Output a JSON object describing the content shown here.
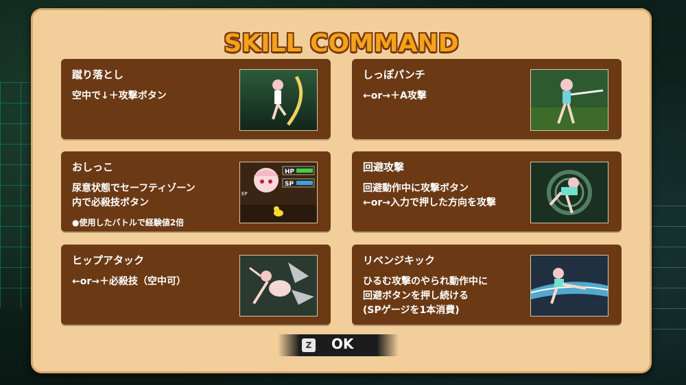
{
  "title": "SKILL COMMAND",
  "skills": [
    {
      "name": "蹴り落とし",
      "desc": "空中で↓＋攻撃ボタン",
      "note": "",
      "thumb_icon": "kick-down-scene"
    },
    {
      "name": "しっぽパンチ",
      "desc": "←or→＋A攻撃",
      "note": "",
      "thumb_icon": "tail-punch-scene"
    },
    {
      "name": "おしっこ",
      "desc": "尿意状態でセーフティゾーン\n内で必殺技ボタン",
      "note": "●使用したバトルで経験値2倍",
      "thumb_icon": "status-portrait-scene"
    },
    {
      "name": "回避攻撃",
      "desc": "回避動作中に攻撃ボタン\n←or→入力で押した方向を攻撃",
      "note": "",
      "thumb_icon": "dodge-attack-scene"
    },
    {
      "name": "ヒップアタック",
      "desc": "←or→＋必殺技（空中可）",
      "note": "",
      "thumb_icon": "hip-attack-scene"
    },
    {
      "name": "リベンジキック",
      "desc": "ひるむ攻撃のやられ動作中に\n回避ボタンを押し続ける\n(SPゲージを1本消費)",
      "note": "",
      "thumb_icon": "revenge-kick-scene"
    }
  ],
  "thumb_hud": {
    "hp": "HP",
    "sp": "SP",
    "ep": "EP"
  },
  "confirm": {
    "key": "Z",
    "label": "OK"
  },
  "colors": {
    "panel": "#f2cf9a",
    "card": "#6b3a15",
    "title": "#f4a21c"
  }
}
